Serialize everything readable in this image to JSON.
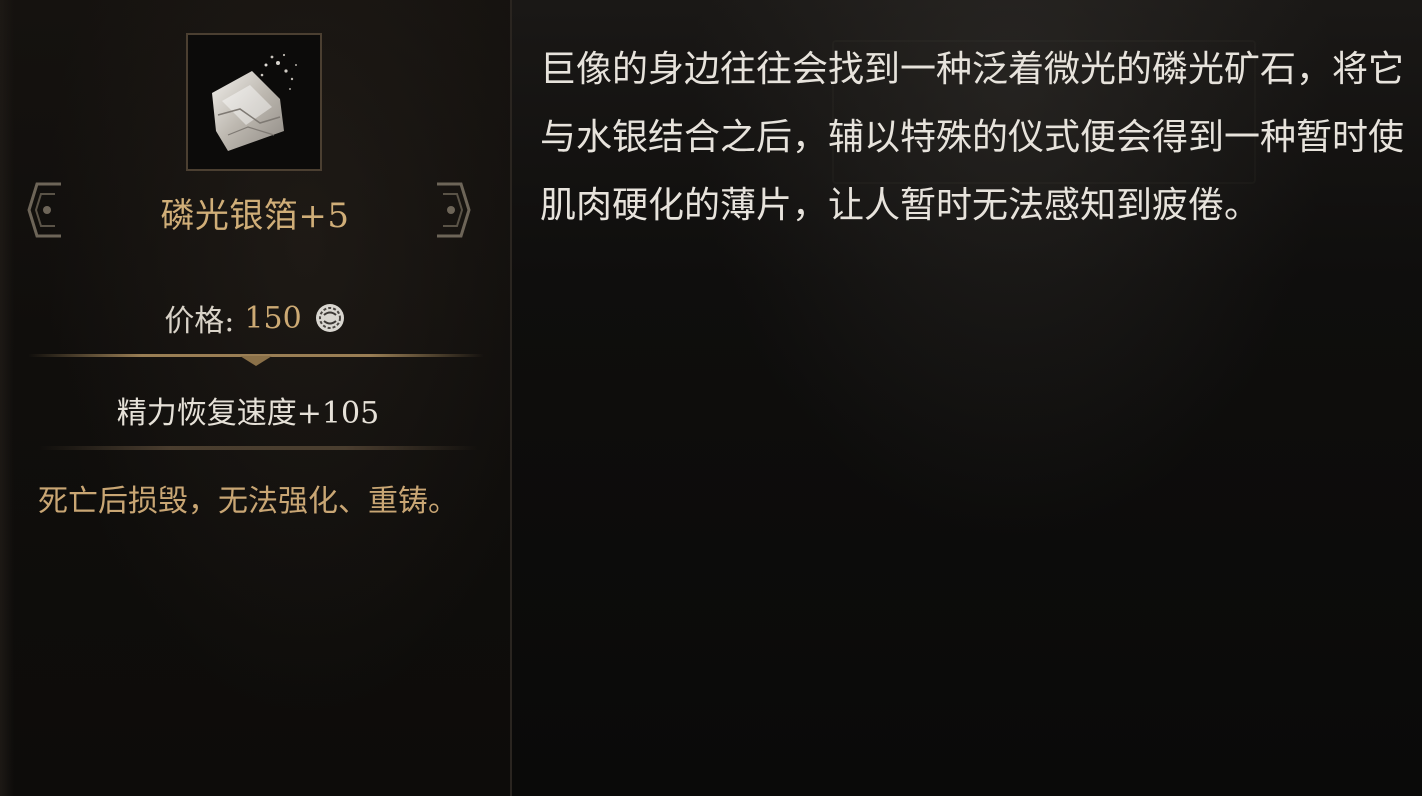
{
  "item": {
    "name": "磷光银箔+5",
    "icon": "silver-foil-item-icon",
    "price_label": "价格: ",
    "price_value": "150",
    "currency_icon": "currency-coin-icon",
    "stat": "精力恢复速度+105",
    "warning": "死亡后损毁，无法强化、重铸。"
  },
  "description": {
    "text": "巨像的身边往往会找到一种泛着微光的磷光矿石，将它与水银结合之后，辅以特殊的仪式便会得到一种暂时使肌肉硬化的薄片，让人暂时无法感知到疲倦。"
  },
  "colors": {
    "item_name": "#d0ae78",
    "price_value": "#cdaa74",
    "warning": "#c9a674",
    "body_text": "#e7e3dc",
    "frame": "#4b3f31"
  }
}
